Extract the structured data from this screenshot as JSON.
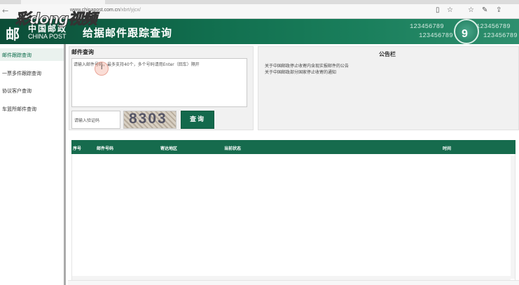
{
  "browser": {
    "url_host": "www.chinapost.com.cn",
    "url_path": "/xbrt/yjcx/",
    "back_glyph": "←",
    "toolbar_icons": [
      "reading-view-icon",
      "favorite-star-icon",
      "favorites-icon",
      "pen-icon",
      "share-icon"
    ]
  },
  "watermark": "彩dong视频",
  "header": {
    "logo_glyph": "邮",
    "logo_cn": "中国邮政",
    "logo_en": "CHINA POST",
    "title": "给据邮件跟踪查询",
    "decor_numbers": [
      "123456789",
      "123456789",
      "123456789",
      "123456789"
    ],
    "clock_digit": "9"
  },
  "sidebar": {
    "items": [
      "邮件跟踪查询",
      "一票多件跟踪查询",
      "协议客户查询",
      "车篮所邮件查询"
    ]
  },
  "query": {
    "title": "邮件查询",
    "placeholder": "请输入邮件号码，最多支持40个，多个号码请用Enter（回车）隔开",
    "captcha_placeholder": "请输入验证码",
    "captcha_value": "8303",
    "button": "查询"
  },
  "notice": {
    "title": "公告栏",
    "items": [
      "关于中国邮政停止收寄内含现实报邮件的公告",
      "关于中国邮政部分国家停止收寄的通知"
    ]
  },
  "results": {
    "columns": [
      "序号",
      "邮件号码",
      "寄达地区",
      "当前状态",
      "时间"
    ]
  },
  "colors": {
    "brand_green": "#166b4d",
    "header_green": "#116e4e"
  }
}
